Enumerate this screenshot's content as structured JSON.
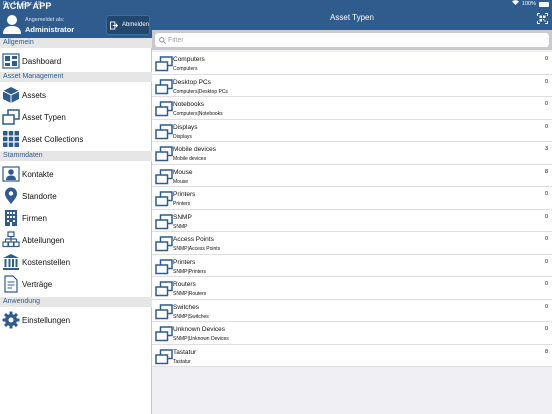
{
  "status_bar": {
    "time": "Do. 14. Dez. 18",
    "battery": "100%"
  },
  "sidebar": {
    "app_title": "ACMP APP",
    "logged_in_as_label": "Angemeldet als:",
    "user_name": "Administrator",
    "logout_label": "Abmelden",
    "sections": {
      "allgemein": "Allgemein",
      "asset_management": "Asset Management",
      "stammdaten": "Stammdaten",
      "anwendung": "Anwendung"
    },
    "items": {
      "dashboard": "Dashboard",
      "assets": "Assets",
      "asset_typen": "Asset Typen",
      "asset_collections": "Asset Collections",
      "kontakte": "Kontakte",
      "standorte": "Standorte",
      "firmen": "Firmen",
      "abteilungen": "Abteilungen",
      "kostenstellen": "Kostenstellen",
      "vertraege": "Verträge",
      "einstellungen": "Einstellungen"
    }
  },
  "main": {
    "title": "Asset Typen",
    "search_placeholder": "Filter",
    "rows": [
      {
        "name": "Computers",
        "path": "Computers",
        "count": "0"
      },
      {
        "name": "Desktop PCs",
        "path": "Computers|Desktop PCs",
        "count": "0"
      },
      {
        "name": "Notebooks",
        "path": "Computers|Notebooks",
        "count": "0"
      },
      {
        "name": "Displays",
        "path": "Displays",
        "count": "0"
      },
      {
        "name": "Mobile devices",
        "path": "Mobile devices",
        "count": "3"
      },
      {
        "name": "Mouse",
        "path": "Mouse",
        "count": "8"
      },
      {
        "name": "Printers",
        "path": "Printers",
        "count": "0"
      },
      {
        "name": "SNMP",
        "path": "SNMP",
        "count": "0"
      },
      {
        "name": "Access Points",
        "path": "SNMP|Access Points",
        "count": "0"
      },
      {
        "name": "Printers",
        "path": "SNMP|Printers",
        "count": "0"
      },
      {
        "name": "Routers",
        "path": "SNMP|Routers",
        "count": "0"
      },
      {
        "name": "Switches",
        "path": "SNMP|Switches",
        "count": "0"
      },
      {
        "name": "Unknown Devices",
        "path": "SNMP|Unknown Devices",
        "count": "0"
      },
      {
        "name": "Tastatur",
        "path": "Tastatur",
        "count": "8"
      }
    ]
  },
  "colors": {
    "header_blue": "#2f5c8c",
    "icon_blue": "#2f5c8c",
    "section_bg": "#e6e6e6"
  }
}
